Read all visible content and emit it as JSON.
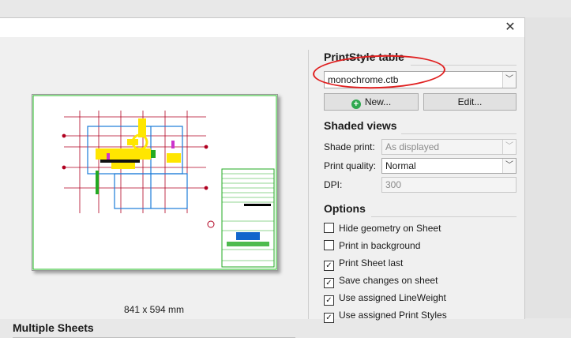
{
  "paper_size": "841 x 594 mm",
  "multiple_sheets_title": "Multiple Sheets",
  "print_style": {
    "title": "PrintStyle table",
    "selected": "monochrome.ctb",
    "new_label": "New...",
    "edit_label": "Edit..."
  },
  "shaded_views": {
    "title": "Shaded views",
    "shade_print_label": "Shade print:",
    "shade_print_value": "As displayed",
    "print_quality_label": "Print quality:",
    "print_quality_value": "Normal",
    "dpi_label": "DPI:",
    "dpi_value": "300"
  },
  "options": {
    "title": "Options",
    "items": [
      {
        "label": "Hide geometry on Sheet",
        "checked": false
      },
      {
        "label": "Print in background",
        "checked": false
      },
      {
        "label": "Print Sheet last",
        "checked": true
      },
      {
        "label": "Save changes on sheet",
        "checked": true
      },
      {
        "label": "Use assigned LineWeight",
        "checked": true
      },
      {
        "label": "Use assigned Print Styles",
        "checked": true
      }
    ]
  },
  "colors": {
    "annotation": "#e02020",
    "plus_icon": "#2fa84f"
  }
}
